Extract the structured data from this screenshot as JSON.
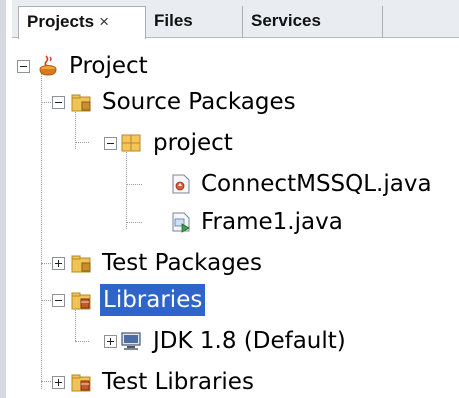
{
  "tabs": [
    {
      "label": "Projects",
      "close": "×"
    },
    {
      "label": "Files"
    },
    {
      "label": "Services"
    }
  ],
  "tree": {
    "project": "Project",
    "source_packages": "Source Packages",
    "package_project": "project",
    "file_connect": "ConnectMSSQL.java",
    "file_frame": "Frame1.java",
    "test_packages": "Test Packages",
    "libraries": "Libraries",
    "jdk": "JDK 1.8 (Default)",
    "test_libraries": "Test Libraries"
  },
  "colors": {
    "selection": "#2f65ca",
    "folder": "#e8b43c",
    "tabbar": "#e9ecf1"
  }
}
